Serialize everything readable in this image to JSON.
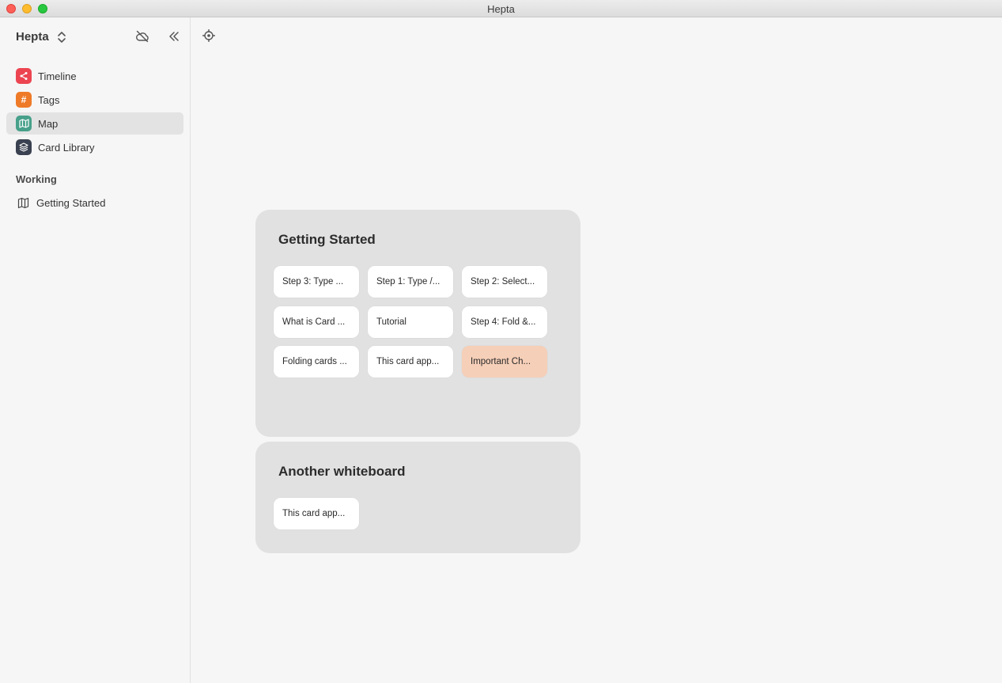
{
  "window": {
    "title": "Hepta"
  },
  "sidebar": {
    "workspace_name": "Hepta",
    "nav": [
      {
        "label": "Timeline",
        "icon": "timeline-icon",
        "color": "#ec4551",
        "active": false
      },
      {
        "label": "Tags",
        "icon": "hash-icon",
        "color": "#ee7a28",
        "active": false
      },
      {
        "label": "Map",
        "icon": "map-icon",
        "color": "#47a08a",
        "active": true
      },
      {
        "label": "Card Library",
        "icon": "layers-icon",
        "color": "#3a4150",
        "active": false
      }
    ],
    "working_section_label": "Working",
    "working_items": [
      {
        "label": "Getting Started",
        "icon": "map-outline-icon"
      }
    ]
  },
  "boards": [
    {
      "title": "Getting Started",
      "cards": [
        {
          "label": "Step 3: Type ...",
          "highlight": false
        },
        {
          "label": "Step 1: Type /...",
          "highlight": false
        },
        {
          "label": "Step 2: Select...",
          "highlight": false
        },
        {
          "label": "What is Card ...",
          "highlight": false
        },
        {
          "label": "Tutorial",
          "highlight": false
        },
        {
          "label": "Step 4: Fold &...",
          "highlight": false
        },
        {
          "label": "Folding cards ...",
          "highlight": false
        },
        {
          "label": "This card app...",
          "highlight": false
        },
        {
          "label": "Important Ch...",
          "highlight": true,
          "color": "#f6cfb8"
        }
      ]
    },
    {
      "title": "Another whiteboard",
      "cards": [
        {
          "label": "This card app...",
          "highlight": false
        }
      ]
    }
  ]
}
